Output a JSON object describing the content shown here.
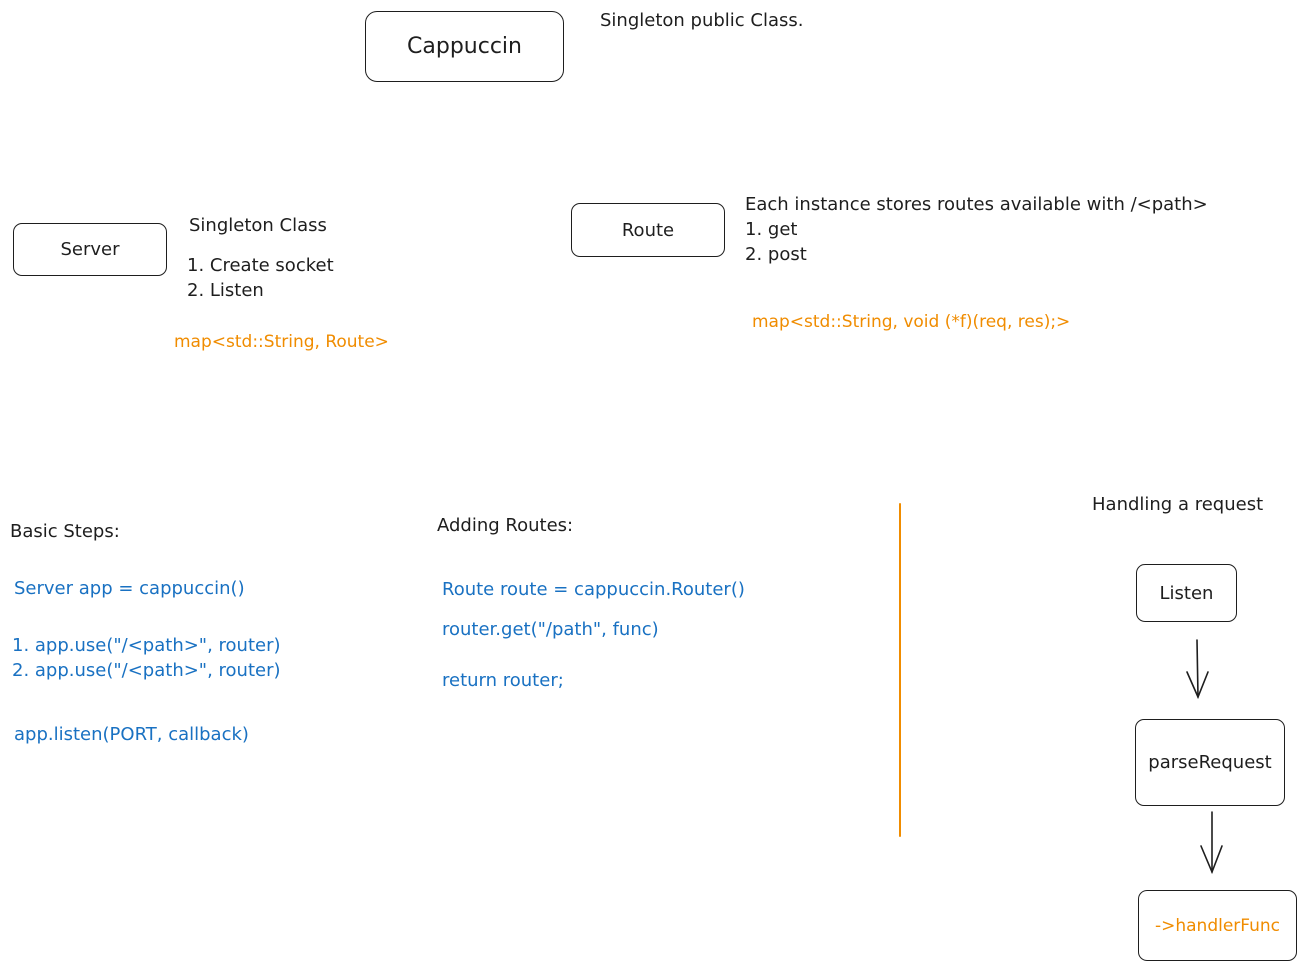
{
  "colors": {
    "ink": "#1e1e1e",
    "code_blue": "#1971c2",
    "accent_orange": "#f08c00"
  },
  "cappuccin": {
    "label": "Cappuccin",
    "note": "Singleton public Class."
  },
  "server": {
    "label": "Server",
    "title": "Singleton Class",
    "steps": [
      "1. Create socket",
      "2. Listen"
    ],
    "map": "map<std::String, Route>"
  },
  "route": {
    "label": "Route",
    "description": "Each instance stores routes available with /<path>",
    "methods": [
      "1. get",
      "2. post"
    ],
    "map": "map<std::String, void (*f)(req, res);>"
  },
  "basic_steps": {
    "heading": "Basic Steps:",
    "code": [
      "Server app = cappuccin()",
      "1. app.use(\"/<path>\", router)",
      "2. app.use(\"/<path>\", router)",
      "app.listen(PORT, callback)"
    ]
  },
  "adding_routes": {
    "heading": "Adding Routes:",
    "code": [
      "Route route = cappuccin.Router()",
      "router.get(\"/path\", func)",
      "return router;"
    ]
  },
  "handling": {
    "heading": "Handling a request",
    "steps": [
      "Listen",
      "parseRequest",
      "->handlerFunc"
    ]
  }
}
